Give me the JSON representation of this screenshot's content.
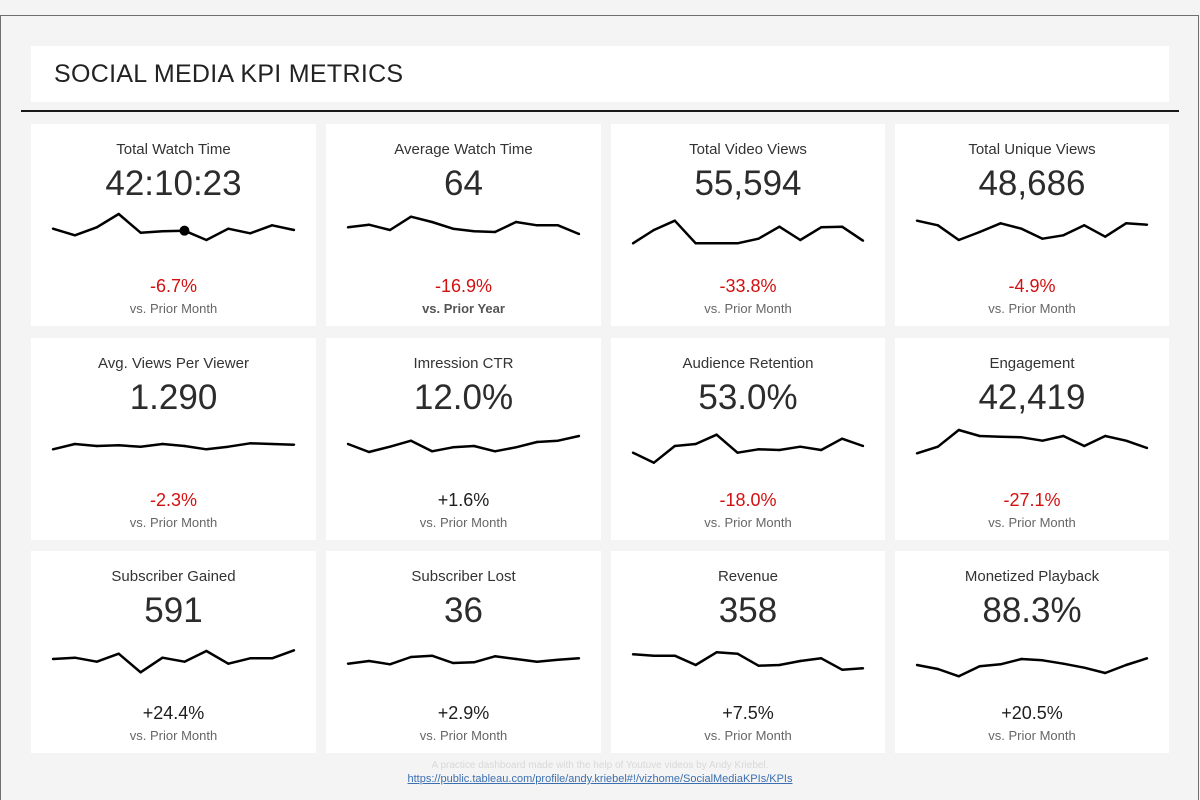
{
  "dashboard": {
    "title": "SOCIAL MEDIA KPI METRICS",
    "footer_note": "A practice dashboard made with the help of Youtuve videos by Andy Kriebel.",
    "footer_link": "https://public.tableau.com/profile/andy.kriebel#!/vizhome/SocialMediaKPIs/KPIs"
  },
  "colors": {
    "negative": "#d40f0f",
    "positive": "#1e1e1e",
    "sparkline": "#000000"
  },
  "kpis": [
    {
      "label": "Total Watch Time",
      "value": "42:10:23",
      "change": "-6.7%",
      "direction": "negative",
      "comparison": "vs. Prior Month",
      "chart_data": {
        "type": "line",
        "values": [
          50,
          40,
          52,
          72,
          44,
          46,
          47,
          33,
          50,
          43,
          55,
          48
        ],
        "highlight_index": 6
      }
    },
    {
      "label": "Average Watch Time",
      "value": "64",
      "change": "-16.9%",
      "direction": "negative",
      "comparison": "vs. Prior Year",
      "chart_data": {
        "type": "line",
        "values": [
          52,
          56,
          48,
          68,
          60,
          50,
          46,
          45,
          60,
          55,
          55,
          42
        ]
      }
    },
    {
      "label": "Total Video Views",
      "value": "55,594",
      "change": "-33.8%",
      "direction": "negative",
      "comparison": "vs. Prior Month",
      "chart_data": {
        "type": "line",
        "values": [
          28,
          48,
          62,
          28,
          28,
          28,
          35,
          53,
          33,
          52,
          53,
          32
        ]
      }
    },
    {
      "label": "Total Unique Views",
      "value": "48,686",
      "change": "-4.9%",
      "direction": "negative",
      "comparison": "vs. Prior Month",
      "chart_data": {
        "type": "line",
        "values": [
          62,
          55,
          33,
          45,
          58,
          50,
          35,
          40,
          55,
          38,
          58,
          56
        ]
      }
    },
    {
      "label": "Avg. Views Per Viewer",
      "value": "1.290",
      "change": "-2.3%",
      "direction": "negative",
      "comparison": "vs. Prior Month",
      "chart_data": {
        "type": "line",
        "values": [
          40,
          48,
          45,
          46,
          44,
          48,
          45,
          40,
          44,
          49,
          48,
          47
        ]
      }
    },
    {
      "label": "Imression CTR",
      "value": "12.0%",
      "change": "+1.6%",
      "direction": "positive",
      "comparison": "vs. Prior Month",
      "chart_data": {
        "type": "line",
        "values": [
          48,
          36,
          44,
          53,
          37,
          43,
          45,
          37,
          43,
          51,
          53,
          60
        ]
      }
    },
    {
      "label": "Audience Retention",
      "value": "53.0%",
      "change": "-18.0%",
      "direction": "negative",
      "comparison": "vs. Prior Month",
      "chart_data": {
        "type": "line",
        "values": [
          35,
          20,
          45,
          48,
          62,
          35,
          40,
          39,
          44,
          39,
          56,
          45
        ]
      }
    },
    {
      "label": "Engagement",
      "value": "42,419",
      "change": "-27.1%",
      "direction": "negative",
      "comparison": "vs. Prior Month",
      "chart_data": {
        "type": "line",
        "values": [
          34,
          44,
          69,
          60,
          59,
          58,
          53,
          60,
          45,
          60,
          53,
          42
        ]
      }
    },
    {
      "label": "Subscriber Gained",
      "value": "591",
      "change": "+24.4%",
      "direction": "positive",
      "comparison": "vs. Prior Month",
      "chart_data": {
        "type": "line",
        "values": [
          45,
          47,
          41,
          53,
          25,
          47,
          41,
          57,
          38,
          46,
          46,
          58
        ]
      }
    },
    {
      "label": "Subscriber Lost",
      "value": "36",
      "change": "+2.9%",
      "direction": "positive",
      "comparison": "vs. Prior Month",
      "chart_data": {
        "type": "line",
        "values": [
          38,
          42,
          37,
          48,
          50,
          39,
          40,
          49,
          45,
          41,
          44,
          46
        ]
      }
    },
    {
      "label": "Revenue",
      "value": "358",
      "change": "+7.5%",
      "direction": "positive",
      "comparison": "vs. Prior Month",
      "chart_data": {
        "type": "line",
        "values": [
          52,
          50,
          50,
          36,
          55,
          53,
          35,
          36,
          42,
          46,
          29,
          31
        ]
      }
    },
    {
      "label": "Monetized Playback",
      "value": "88.3%",
      "change": "+20.5%",
      "direction": "positive",
      "comparison": "vs. Prior Month",
      "chart_data": {
        "type": "line",
        "values": [
          36,
          30,
          19,
          34,
          37,
          45,
          43,
          38,
          32,
          24,
          36,
          46
        ]
      }
    }
  ]
}
